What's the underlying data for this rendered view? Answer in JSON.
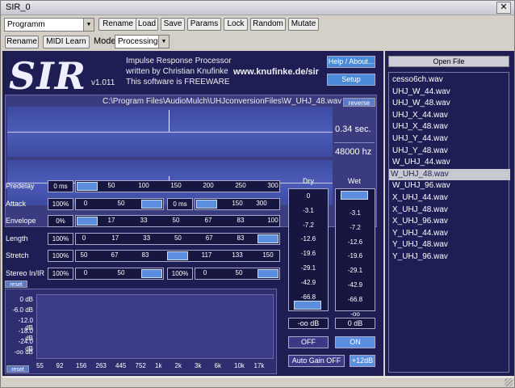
{
  "window": {
    "title": "SIR_0"
  },
  "host": {
    "program_value": "Programm",
    "row1_buttons": [
      "Rename",
      "Load",
      "Save",
      "Params",
      "Lock",
      "Random",
      "Mutate"
    ],
    "row2_buttons": [
      "Rename",
      "MIDI Learn"
    ],
    "mode_label": "Mode",
    "mode_value": "Processing"
  },
  "plugin": {
    "logo": "SIR",
    "version": "v1.011",
    "info_lines": [
      "Impulse Response Processor",
      "written by Christian Knufinke",
      "This software is FREEWARE"
    ],
    "url": "www.knufinke.de/sir",
    "help_button": "Help / About...",
    "setup_button": "Setup",
    "file_path": "C:\\Program Files\\AudioMulch\\UHJconversionFiles\\W_UHJ_48.wav",
    "reverse_button": "reverse",
    "length_display": "0.34 sec.",
    "rate_display": "48000 hz",
    "reset_label": "reset",
    "params": [
      {
        "name": "Predelay",
        "value": "0 ms",
        "ticks": [
          "50",
          "100",
          "150",
          "200",
          "250",
          "300"
        ],
        "level": 0
      },
      {
        "name": "Attack",
        "value": "100%",
        "ticks": [
          "0",
          "50"
        ],
        "level": 1,
        "value2": "0 ms",
        "ticks2": [
          "150",
          "300"
        ],
        "level2": 0
      },
      {
        "name": "Envelope",
        "value": "0%",
        "ticks": [
          "17",
          "33",
          "50",
          "67",
          "83",
          "100"
        ],
        "level": 0
      },
      {
        "name": "Length",
        "value": "100%",
        "ticks": [
          "0",
          "17",
          "33",
          "50",
          "67",
          "83"
        ],
        "level": 1
      },
      {
        "name": "Stretch",
        "value": "100%",
        "ticks": [
          "50",
          "67",
          "83",
          "117",
          "133",
          "150"
        ],
        "level": 0.5
      },
      {
        "name": "Stereo In/IR",
        "value": "100%",
        "ticks": [
          "0",
          "50"
        ],
        "level": 1,
        "value2": "100%",
        "ticks2": [
          "0",
          "50"
        ],
        "level2": 1
      }
    ],
    "eq": {
      "db_labels": [
        "0 dB",
        "-6.0 dB",
        "-12.0 dB",
        "-18.0 dB",
        "-24.0 dB",
        "-oo dB"
      ],
      "freq_labels": [
        "55",
        "92",
        "156",
        "263",
        "445",
        "752",
        "1k",
        "2k",
        "3k",
        "6k",
        "10k",
        "17k"
      ]
    },
    "dry": {
      "title": "Dry",
      "marks": [
        "0",
        "-3.1",
        "-7.2",
        "-12.6",
        "-19.6",
        "-29.1",
        "-42.9",
        "-66.8"
      ],
      "value": "-oo dB",
      "level": 0
    },
    "wet": {
      "title": "Wet",
      "marks": [
        "-3.1",
        "-7.2",
        "-12.6",
        "-19.6",
        "-29.1",
        "-42.9",
        "-66.8",
        "-oo"
      ],
      "value": "0 dB",
      "level": 1
    },
    "off_button": "OFF",
    "on_button": "ON",
    "autogain_button": "Auto Gain OFF",
    "gain_value": "+12dB"
  },
  "files": {
    "open_button": "Open File",
    "items": [
      "cesso6ch.wav",
      "UHJ_W_44.wav",
      "UHJ_W_48.wav",
      "UHJ_X_44.wav",
      "UHJ_X_48.wav",
      "UHJ_Y_44.wav",
      "UHJ_Y_48.wav",
      "W_UHJ_44.wav",
      "W_UHJ_48.wav",
      "W_UHJ_96.wav",
      "X_UHJ_44.wav",
      "X_UHJ_48.wav",
      "X_UHJ_96.wav",
      "Y_UHJ_44.wav",
      "Y_UHJ_48.wav",
      "Y_UHJ_96.wav"
    ],
    "selected_index": 8
  },
  "colors": {
    "panel": "#1e1e55",
    "accent": "#5c8ee0",
    "selection": "#c8c8d0"
  }
}
